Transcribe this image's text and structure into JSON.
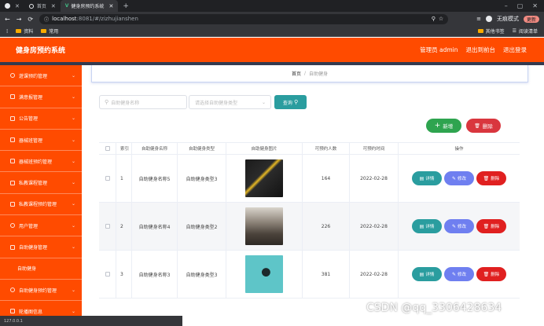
{
  "browser": {
    "tabs": [
      {
        "label": "",
        "active": false
      },
      {
        "label": "首页",
        "active": false
      },
      {
        "label": "健身房预约系统",
        "active": true
      }
    ],
    "address": {
      "host": "localhost",
      "rest": ":8081/#/zizhujianshen"
    },
    "profile_label": "无痕模式",
    "update_label": "更新",
    "bookmarks": [
      "资料",
      "常用"
    ],
    "bookmarks_right": [
      "其他书签",
      "阅读清单"
    ],
    "status_text": "127.0.0.1"
  },
  "header": {
    "title": "健身房预约系统",
    "user": "管理员 admin",
    "back_label": "退出到前台",
    "logout_label": "退出登录",
    "accent": "#ff4b00"
  },
  "sidebar": {
    "items": [
      {
        "label": "遊课预约管理",
        "icon": "location-icon",
        "sub": false
      },
      {
        "label": "满意报管理",
        "icon": "document-icon",
        "sub": false
      },
      {
        "label": "公告管理",
        "icon": "bar-chart-icon",
        "sub": false
      },
      {
        "label": "器械班管理",
        "icon": "grid-icon",
        "sub": false
      },
      {
        "label": "器械班预约管理",
        "icon": "grid-icon",
        "sub": false
      },
      {
        "label": "私教课程管理",
        "icon": "grid-icon",
        "sub": false
      },
      {
        "label": "私教课程预约管理",
        "icon": "phone-icon",
        "sub": false
      },
      {
        "label": "用户管理",
        "icon": "location-icon",
        "sub": false
      },
      {
        "label": "自助健身管理",
        "icon": "expand-icon",
        "sub": false
      },
      {
        "label": "自助健身",
        "icon": "",
        "sub": true
      },
      {
        "label": "自助健身预约管理",
        "icon": "clock-icon",
        "sub": false
      },
      {
        "label": "轮播图信息",
        "icon": "grid-icon",
        "sub": false
      }
    ]
  },
  "breadcrumb": {
    "home": "首页",
    "sep": "/",
    "current": "自助健身"
  },
  "filters": {
    "name_placeholder": "自助健身名称",
    "type_placeholder": "请选择自助健身类型",
    "query_label": "查询"
  },
  "actions": {
    "add_label": "新增",
    "delete_label": "删除"
  },
  "table": {
    "headers": [
      "",
      "索引",
      "自助健身名称",
      "自助健身类型",
      "自助健身图片",
      "可预约人数",
      "可预约时间",
      "操作"
    ],
    "op_labels": {
      "detail": "详情",
      "edit": "修改",
      "remove": "删除"
    },
    "rows": [
      {
        "index": "1",
        "name": "自助健身名称5",
        "type": "自助健身类型3",
        "count": "164",
        "date": "2022-02-28",
        "img": "dark"
      },
      {
        "index": "2",
        "name": "自助健身名称4",
        "type": "自助健身类型2",
        "count": "226",
        "date": "2022-02-28",
        "img": "gym"
      },
      {
        "index": "3",
        "name": "自助健身名称3",
        "type": "自助健身类型3",
        "count": "381",
        "date": "2022-02-28",
        "img": "teal"
      }
    ]
  },
  "watermark": "CSDN @qq_3306428634"
}
